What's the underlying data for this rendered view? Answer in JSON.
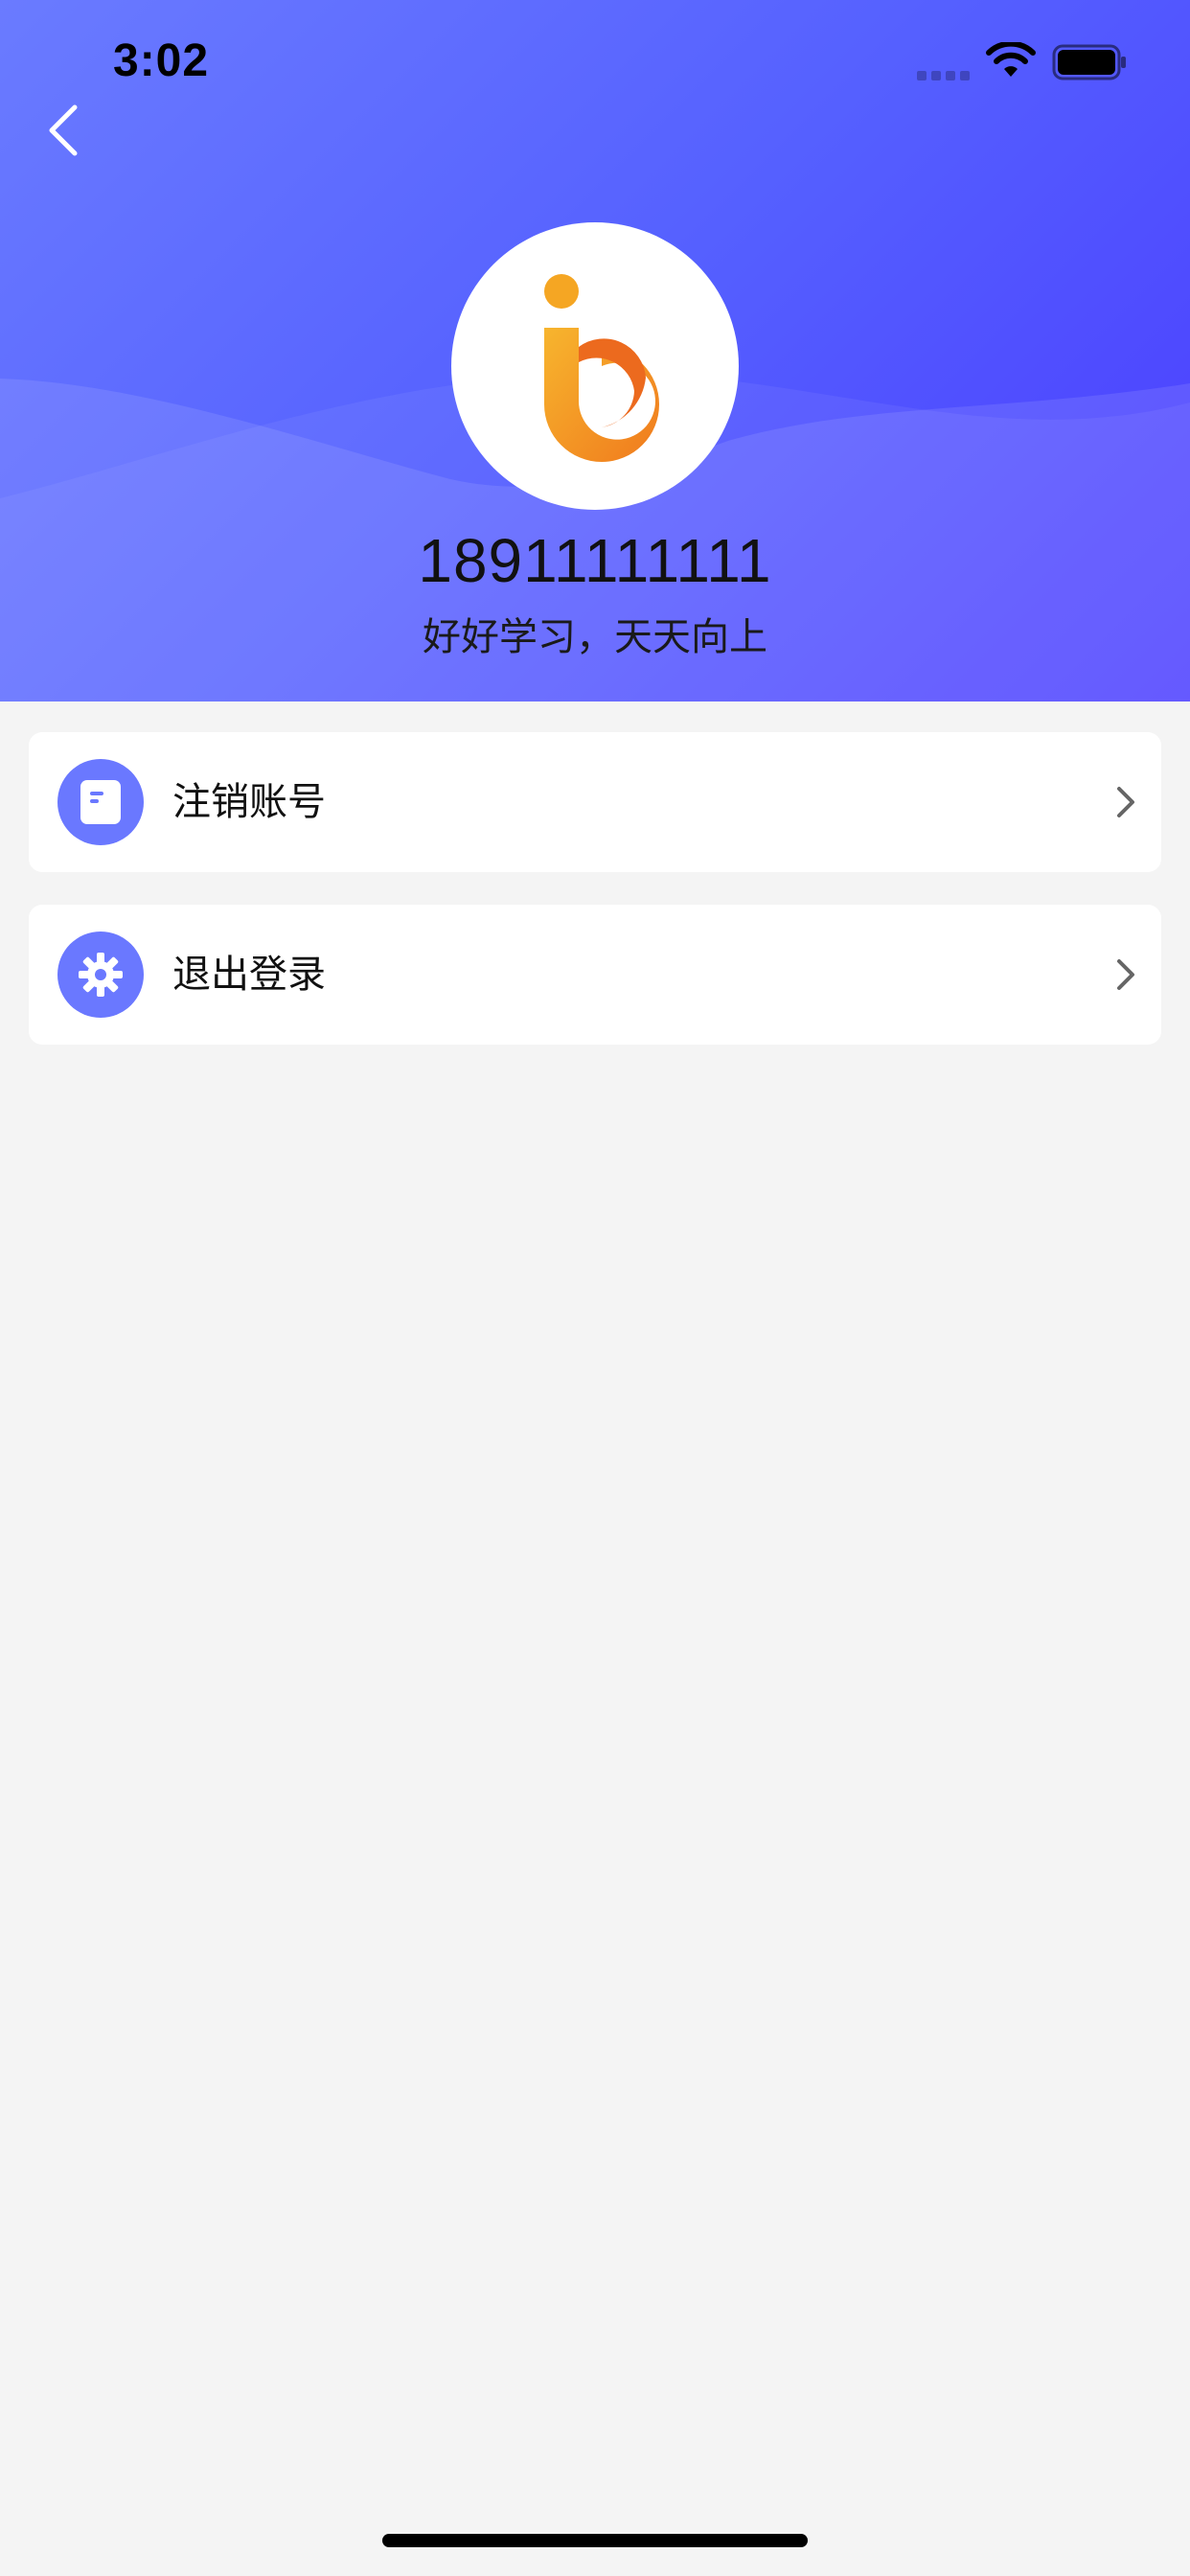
{
  "status_bar": {
    "time": "3:02"
  },
  "profile": {
    "username": "18911111111",
    "motto": "好好学习，天天向上"
  },
  "menu": [
    {
      "label": "注销账号",
      "icon": "document-icon"
    },
    {
      "label": "退出登录",
      "icon": "gear-icon"
    }
  ],
  "colors": {
    "header_gradient_start": "#6a7bff",
    "header_gradient_end": "#4a3cff",
    "menu_icon_bg": "#6a78ff",
    "logo_orange": "#f5a623",
    "page_bg": "#f4f4f4"
  },
  "icons": {
    "back": "chevron-left-icon",
    "signal": "signal-icon",
    "wifi": "wifi-icon",
    "battery": "battery-icon",
    "avatar_logo": "app-logo",
    "row_arrow": "chevron-right-icon"
  }
}
